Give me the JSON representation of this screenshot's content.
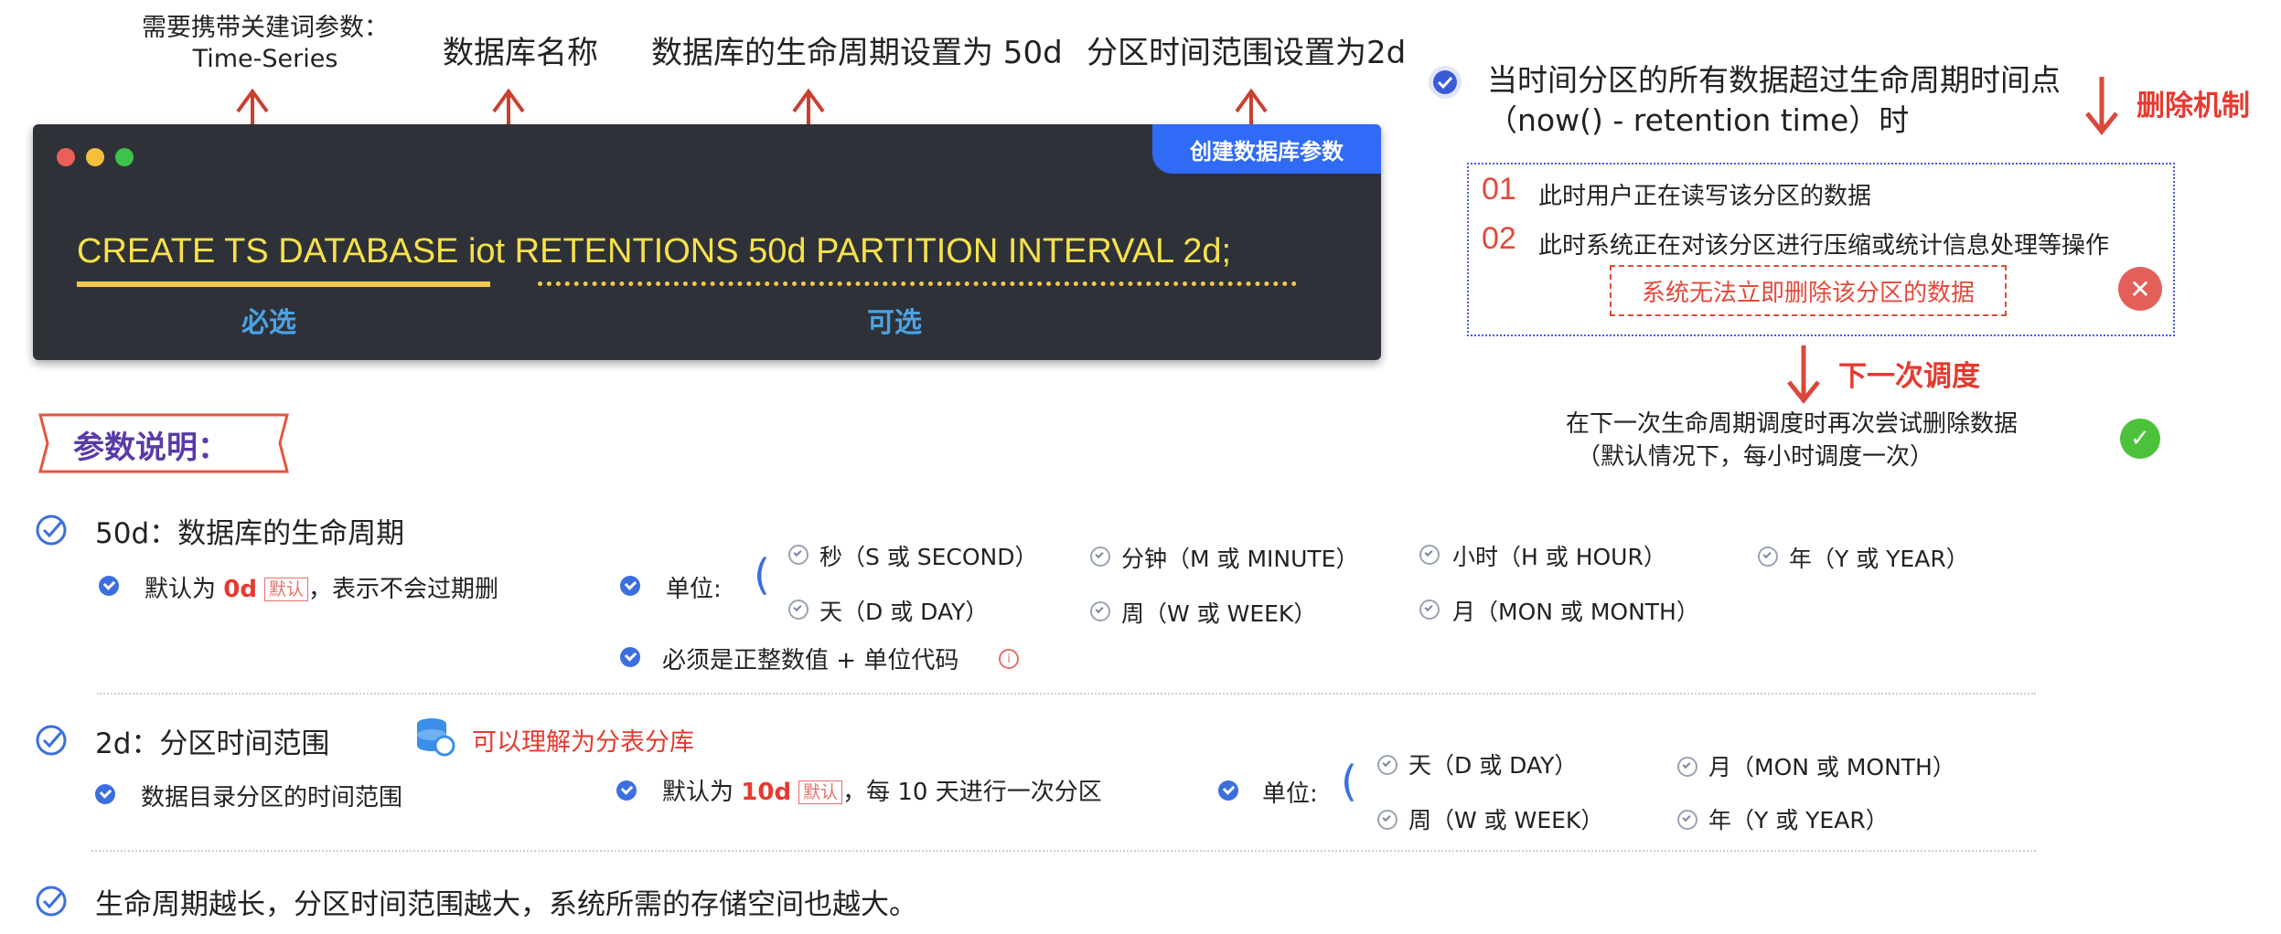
{
  "annotations": {
    "keyword": "需要携带关建词参数：",
    "keyword_value": "Time-Series",
    "db_name": "数据库名称",
    "retention": "数据库的生命周期设置为 50d",
    "partition": "分区时间范围设置为2d"
  },
  "terminal": {
    "tab_label": "创建数据库参数",
    "sql_segments": [
      "CREATE TS DATABASE iot",
      " ",
      "RETENTIONS 50d",
      " ",
      "PARTITION INTERVAL 2d;"
    ],
    "required_label": "必选",
    "optional_label": "可选"
  },
  "deletion": {
    "condition_line1": "当时间分区的所有数据超过生命周期时间点",
    "condition_line2": "（now() - retention time）时",
    "mechanism_title": "删除机制",
    "items": [
      {
        "num": "01",
        "text": "此时用户正在读写该分区的数据"
      },
      {
        "num": "02",
        "text": "此时系统正在对该分区进行压缩或统计信息处理等操作"
      }
    ],
    "cannot_delete": "系统无法立即删除该分区的数据",
    "next_title": "下一次调度",
    "retry_line1": "在下一次生命周期调度时再次尝试删除数据",
    "retry_line2": "（默认情况下，每小时调度一次）"
  },
  "params": {
    "section_title": "参数说明：",
    "retention": {
      "title": "50d：数据库的生命周期",
      "default_prefix": "默认为",
      "default_value": "0d",
      "default_badge": "默认",
      "default_suffix": "，表示不会过期删",
      "unit_label": "单位:",
      "units": [
        "秒（S 或 SECOND）",
        "分钟（M 或 MINUTE）",
        "小时（H 或 HOUR）",
        "年（Y 或 YEAR）",
        "天（D 或 DAY）",
        "周（W 或 WEEK）",
        "月（MON 或 MONTH）"
      ],
      "must_note": "必须是正整数值 + 单位代码"
    },
    "partition": {
      "title": "2d：分区时间范围",
      "hint": "可以理解为分表分库",
      "desc": "数据目录分区的时间范围",
      "default_prefix": "默认为",
      "default_value": "10d",
      "default_badge": "默认",
      "default_suffix": "，每 10 天进行一次分区",
      "unit_label": "单位:",
      "units": [
        "天（D 或 DAY）",
        "月（MON 或 MONTH）",
        "周（W 或 WEEK）",
        "年（Y 或 YEAR）"
      ]
    },
    "conclusion": "生命周期越长，分区时间范围越大，系统所需的存储空间也越大。"
  },
  "colors": {
    "accent_blue": "#2f6bf6",
    "warning_red": "#e53a30",
    "sql_yellow": "#f7e14b",
    "ok_green": "#4cc23a"
  }
}
